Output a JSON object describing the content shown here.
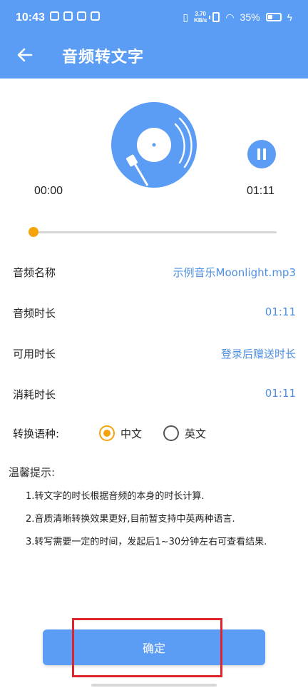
{
  "status_bar": {
    "time": "10:43",
    "net_speed_value": "3.70",
    "net_speed_unit": "KB/s",
    "battery": "35%"
  },
  "header": {
    "title": "音频转文字",
    "back_icon": "arrow-left-icon"
  },
  "player": {
    "current_time": "00:00",
    "total_time": "01:11",
    "progress": 0.0,
    "state_icon": "pause-icon",
    "accent_color": "#f5a30a",
    "disc_color": "#5b9cf4"
  },
  "info": {
    "rows": [
      {
        "label": "音频名称",
        "value": "示例音乐Moonlight.mp3"
      },
      {
        "label": "音频时长",
        "value": "01:11"
      },
      {
        "label": "可用时长",
        "value": "登录后赠送时长"
      },
      {
        "label": "消耗时长",
        "value": "01:11"
      }
    ]
  },
  "language": {
    "label": "转换语种:",
    "options": [
      {
        "label": "中文",
        "selected": true
      },
      {
        "label": "英文",
        "selected": false
      }
    ]
  },
  "tips": {
    "title": "温馨提示:",
    "items": [
      "1.转文字的时长根据音频的本身的时长计算.",
      "2.音质清晰转换效果更好,目前暂支持中英两种语言.",
      "3.转写需要一定的时间，发起后1~30分钟左右可查看结果."
    ]
  },
  "confirm_button": {
    "label": "确定"
  },
  "theme": {
    "primary": "#5b9cf4",
    "link": "#4f8fe0",
    "highlight": "#e0242b"
  }
}
